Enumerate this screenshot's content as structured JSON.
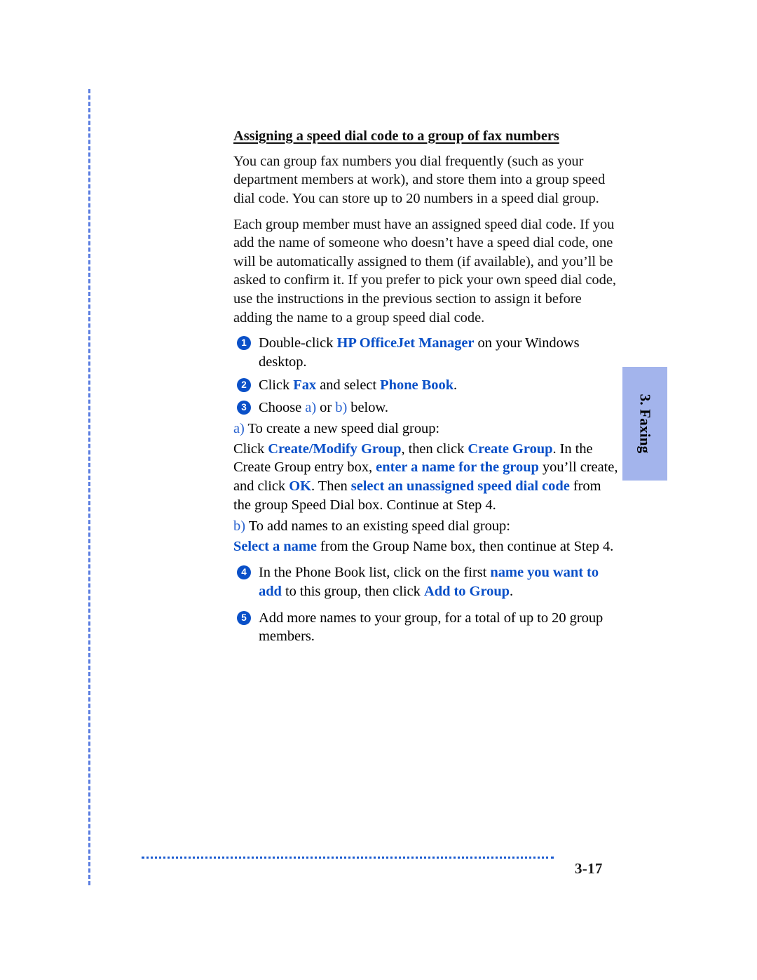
{
  "colors": {
    "accent_blue": "#0a50c8",
    "letter_blue": "#2a63cf",
    "tab_blue": "#a3b4ec",
    "rule_blue": "#1a5ad0",
    "margin_dash_blue": "#5a7de0",
    "text_black": "#121212"
  },
  "side_tab": {
    "label": "3. Faxing"
  },
  "footer": {
    "page_number": "3-17"
  },
  "content": {
    "heading": "Assigning a speed dial code to a group of fax numbers",
    "paragraphs": [
      "You can group fax numbers you dial frequently (such as your department members at work), and store them into a group speed dial code. You can store up to 20 numbers in a speed dial group.",
      "Each group member must have an assigned speed dial code. If you add the name of someone who doesn’t have a speed dial code, one will be automatically assigned to them (if available), and you’ll be asked to confirm it. If you prefer to pick your own speed dial code, use the instructions in the previous section to assign it before adding the name to a group speed dial code."
    ],
    "steps": [
      {
        "number": "1",
        "parts": [
          {
            "text": "Double-click ",
            "style": "plain"
          },
          {
            "text": "HP OfficeJet Manager",
            "style": "ui"
          },
          {
            "text": " on your Windows desktop.",
            "style": "plain"
          }
        ]
      },
      {
        "number": "2",
        "parts": [
          {
            "text": "Click ",
            "style": "plain"
          },
          {
            "text": "Fax",
            "style": "ui"
          },
          {
            "text": " and select ",
            "style": "plain"
          },
          {
            "text": "Phone Book",
            "style": "ui"
          },
          {
            "text": ".",
            "style": "plain"
          }
        ]
      },
      {
        "number": "3",
        "parts": [
          {
            "text": "Choose ",
            "style": "plain"
          },
          {
            "text": "a)",
            "style": "letter"
          },
          {
            "text": " or ",
            "style": "plain"
          },
          {
            "text": "b)",
            "style": "letter"
          },
          {
            "text": " below.",
            "style": "plain"
          }
        ]
      },
      {
        "number": "4",
        "parts": [
          {
            "text": "In the Phone Book list, click on the first ",
            "style": "plain"
          },
          {
            "text": "name you want to add",
            "style": "ui"
          },
          {
            "text": " to this group, then click ",
            "style": "plain"
          },
          {
            "text": "Add to Group",
            "style": "ui"
          },
          {
            "text": ".",
            "style": "plain"
          }
        ]
      },
      {
        "number": "5",
        "parts": [
          {
            "text": "Add more names to your group, for a total of up to 20 group members.",
            "style": "plain"
          }
        ]
      }
    ],
    "substeps": [
      {
        "marker": "a)",
        "lead": " To create a new speed dial group:",
        "body_parts": [
          {
            "text": "Click ",
            "style": "plain"
          },
          {
            "text": "Create/Modify Group",
            "style": "ui"
          },
          {
            "text": ", then click ",
            "style": "plain"
          },
          {
            "text": "Create Group",
            "style": "ui"
          },
          {
            "text": ". In the Create Group entry box, ",
            "style": "plain"
          },
          {
            "text": "enter a name for the group",
            "style": "ui"
          },
          {
            "text": " you’ll create, and click ",
            "style": "plain"
          },
          {
            "text": "OK",
            "style": "ui"
          },
          {
            "text": ". Then ",
            "style": "plain"
          },
          {
            "text": "select an unassigned speed dial code",
            "style": "ui"
          },
          {
            "text": " from the group Speed Dial box. Continue at Step 4.",
            "style": "plain"
          }
        ]
      },
      {
        "marker": "b)",
        "lead": " To add names to an existing speed dial group:",
        "body_parts": [
          {
            "text": "Select a name",
            "style": "ui"
          },
          {
            "text": " from the Group Name box, then continue at Step 4.",
            "style": "plain"
          }
        ]
      }
    ]
  }
}
